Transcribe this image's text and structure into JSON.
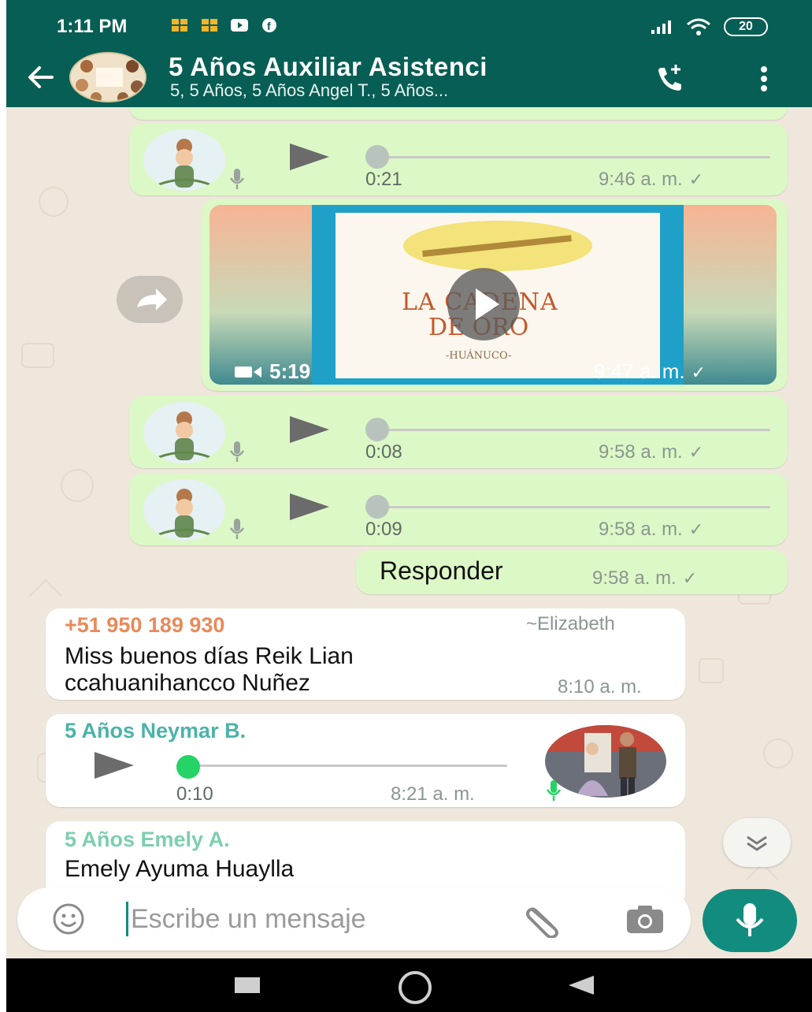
{
  "status_bar": {
    "time": "1:11 PM",
    "battery": "20"
  },
  "header": {
    "title": "5 Años Auxiliar Asistenci",
    "participants": "5, 5 Años, 5 Años Angel T., 5 Años..."
  },
  "messages": {
    "voice1": {
      "duration": "0:21",
      "time": "9:46 a. m.",
      "progress": 0
    },
    "video": {
      "duration": "5:19",
      "time": "9:47 a. m.",
      "thumb_title_line1": "LA CADENA",
      "thumb_title_line2": "DE ORO",
      "thumb_place": "-HUÁNUCO-"
    },
    "voice2": {
      "duration": "0:08",
      "time": "9:58 a. m.",
      "progress": 0
    },
    "voice3": {
      "duration": "0:09",
      "time": "9:58 a. m.",
      "progress": 0
    },
    "reply": {
      "text": "Responder",
      "time": "9:58 a. m."
    },
    "incoming1": {
      "sender": "+51 950 189 930",
      "sender_name": "~Elizabeth",
      "text": "Miss buenos días Reik Lian ccahuanihancco Nuñez",
      "time": "8:10 a. m."
    },
    "incoming2": {
      "sender": "5 Años Neymar B.",
      "duration": "0:10",
      "time": "8:21 a. m.",
      "progress": 0
    },
    "incoming3": {
      "sender": "5 Años Emely A.",
      "text": "Emely Ayuma Huaylla"
    }
  },
  "input": {
    "placeholder": "Escribe un mensaje"
  },
  "colors": {
    "header": "#075e54",
    "accent": "#128c7e",
    "outgoing": "#dcf8c6",
    "incoming": "#ffffff",
    "chat_bg": "#efe7dc",
    "sender_orange": "#e88a5a",
    "sender_teal": "#4bb3a8",
    "sender_green": "#7ccfae"
  }
}
